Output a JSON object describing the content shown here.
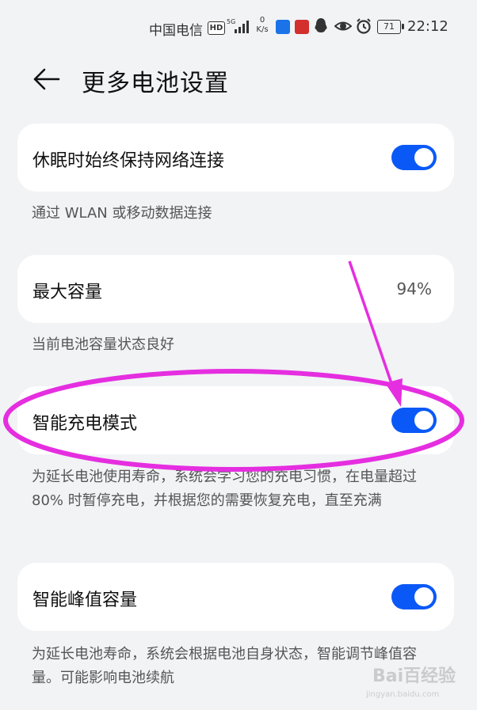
{
  "status_bar": {
    "carrier": "中国电信",
    "hd": "HD",
    "speed_value": "0",
    "speed_unit": "K/s",
    "battery": "71",
    "time": "22:12"
  },
  "header": {
    "back_icon": "arrow-left-icon",
    "title": "更多电池设置"
  },
  "settings": [
    {
      "label": "休眠时始终保持网络连接",
      "toggle_on": true,
      "description": "通过 WLAN 或移动数据连接"
    },
    {
      "label": "最大容量",
      "value": "94%",
      "description": "当前电池容量状态良好"
    },
    {
      "label": "智能充电模式",
      "toggle_on": true,
      "description": "为延长电池使用寿命，系统会学习您的充电习惯，在电量超过 80% 时暂停充电，并根据您的需要恢复充电，直至充满"
    },
    {
      "label": "智能峰值容量",
      "toggle_on": true,
      "description": "为延长电池寿命，系统会根据电池自身状态，智能调节峰值容量。可能影响电池续航"
    }
  ],
  "colors": {
    "accent": "#0a59f7",
    "annotation": "#e52ee0",
    "background": "#f1f3f5"
  },
  "watermark": {
    "main": "Bai百经验",
    "sub": "jingyan.baidu.com"
  }
}
